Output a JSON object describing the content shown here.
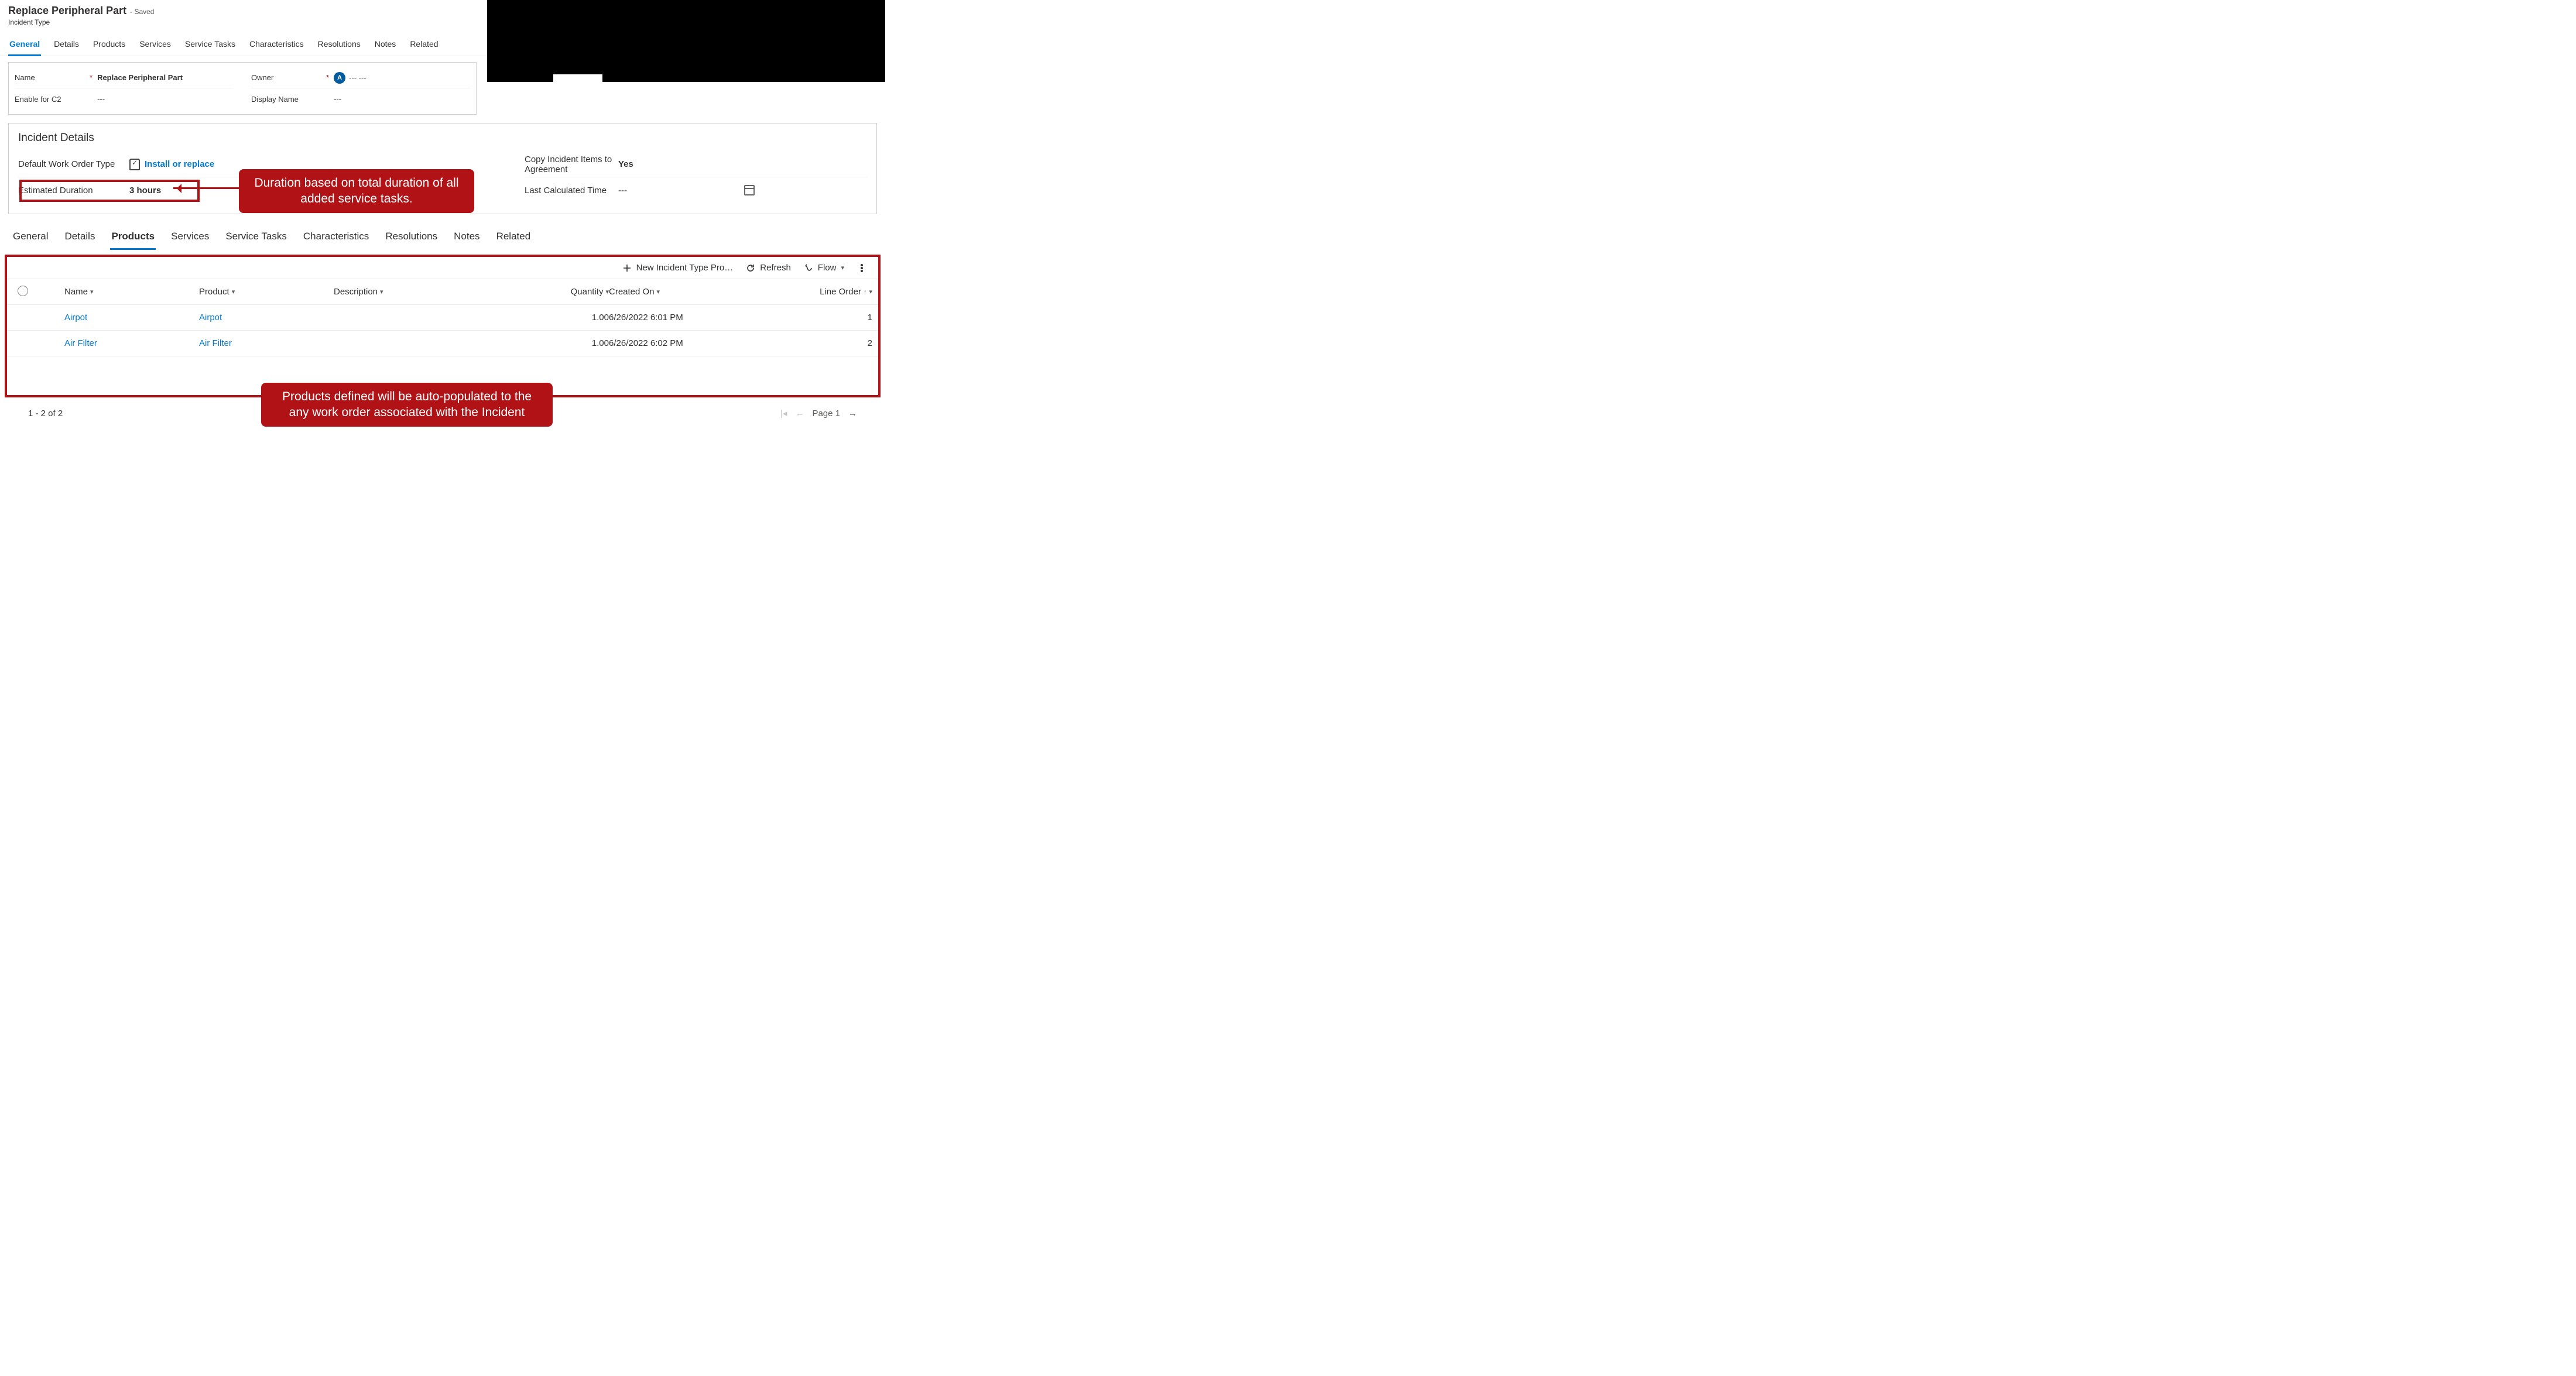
{
  "header": {
    "title": "Replace Peripheral Part",
    "saved": "- Saved",
    "subtitle": "Incident Type"
  },
  "tabs_top": [
    {
      "label": "General",
      "active": true
    },
    {
      "label": "Details"
    },
    {
      "label": "Products"
    },
    {
      "label": "Services"
    },
    {
      "label": "Service Tasks"
    },
    {
      "label": "Characteristics"
    },
    {
      "label": "Resolutions"
    },
    {
      "label": "Notes"
    },
    {
      "label": "Related"
    }
  ],
  "general_form": {
    "name_label": "Name",
    "name_value": "Replace Peripheral Part",
    "enable_label": "Enable for C2",
    "enable_value": "---",
    "owner_label": "Owner",
    "owner_initials": "A",
    "owner_value": "--- ---",
    "display_label": "Display Name",
    "display_value": "---",
    "required": "*"
  },
  "incident_details": {
    "section_title": "Incident Details",
    "wo_type_label": "Default Work Order Type",
    "wo_type_value": "Install or replace",
    "copy_label": "Copy Incident Items to Agreement",
    "copy_value": "Yes",
    "duration_label": "Estimated Duration",
    "duration_value": "3 hours",
    "lasttime_label": "Last Calculated Time",
    "lasttime_value": "---"
  },
  "callout_duration": "Duration based on total duration of all added service tasks.",
  "tabs_bottom": [
    {
      "label": "General"
    },
    {
      "label": "Details"
    },
    {
      "label": "Products",
      "active": true
    },
    {
      "label": "Services"
    },
    {
      "label": "Service Tasks"
    },
    {
      "label": "Characteristics"
    },
    {
      "label": "Resolutions"
    },
    {
      "label": "Notes"
    },
    {
      "label": "Related"
    }
  ],
  "grid": {
    "toolbar": {
      "new_label": "New Incident Type Pro…",
      "refresh_label": "Refresh",
      "flow_label": "Flow"
    },
    "columns": {
      "name": "Name",
      "product": "Product",
      "description": "Description",
      "quantity": "Quantity",
      "created": "Created On",
      "lineorder": "Line Order"
    },
    "rows": [
      {
        "name": "Airpot",
        "product": "Airpot",
        "description": "",
        "quantity": "1.00",
        "created": "6/26/2022 6:01 PM",
        "lineorder": "1"
      },
      {
        "name": "Air Filter",
        "product": "Air Filter",
        "description": "",
        "quantity": "1.00",
        "created": "6/26/2022 6:02 PM",
        "lineorder": "2"
      }
    ],
    "footer": {
      "range": "1 - 2 of 2",
      "page": "Page 1"
    }
  },
  "callout_products": "Products defined will be auto-populated to the any work order associated with the Incident"
}
